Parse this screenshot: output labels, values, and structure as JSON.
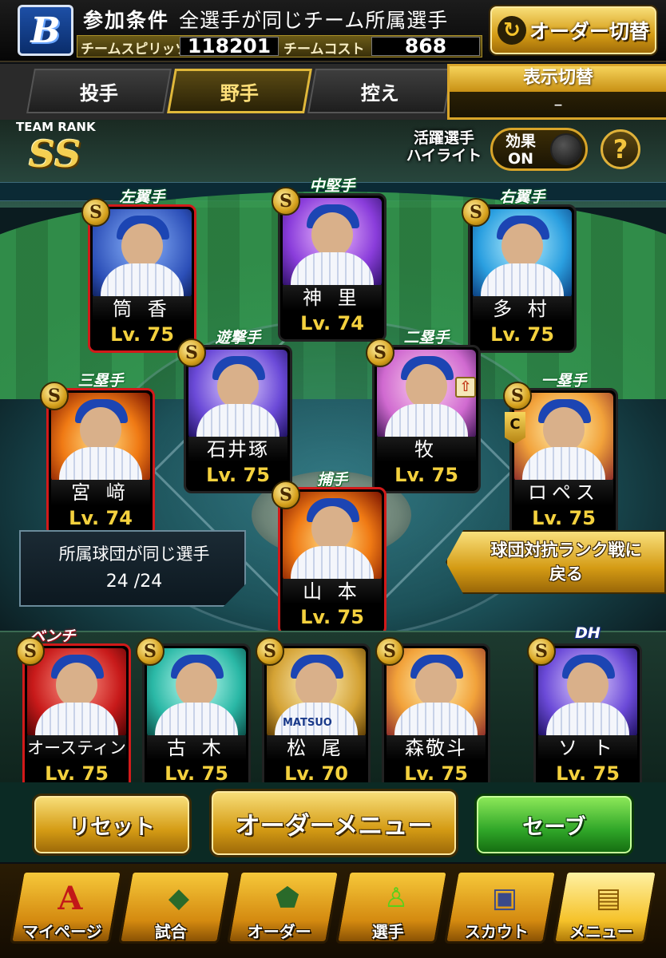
{
  "header": {
    "team_logo": "B",
    "condition_label": "参加条件",
    "condition_text": "全選手が同じチーム所属選手",
    "team_spirit_label": "チームスピリッツ",
    "team_spirit_value": "118201",
    "team_cost_label": "チームコスト",
    "team_cost_value": "868",
    "order_switch_label": "オーダー切替",
    "order_switch_icon": "cycle-arrows-icon"
  },
  "tabs": [
    {
      "label": "投手",
      "active": false
    },
    {
      "label": "野手",
      "active": true
    },
    {
      "label": "控え",
      "active": false
    }
  ],
  "display_switch": {
    "title": "表示切替",
    "value": "–"
  },
  "team_rank": {
    "label": "TEAM RANK",
    "value": "SS"
  },
  "highlight": {
    "label_line1": "活躍選手",
    "label_line2": "ハイライト",
    "effect_label": "効果",
    "effect_state": "ON",
    "help": "?"
  },
  "players": {
    "lf": {
      "position": "左翼手",
      "name": "筒 香",
      "level": "Lv. 75"
    },
    "cf": {
      "position": "中堅手",
      "name": "神 里",
      "level": "Lv. 74"
    },
    "rf": {
      "position": "右翼手",
      "name": "多 村",
      "level": "Lv. 75"
    },
    "ss": {
      "position": "遊撃手",
      "name": "石井琢",
      "level": "Lv. 75"
    },
    "2b": {
      "position": "二塁手",
      "name": "牧",
      "level": "Lv. 75"
    },
    "3b": {
      "position": "三塁手",
      "name": "宮 﨑",
      "level": "Lv. 74"
    },
    "1b": {
      "position": "一塁手",
      "name": "ロペス",
      "level": "Lv. 75"
    },
    "c": {
      "position": "捕手",
      "name": "山 本",
      "level": "Lv. 75"
    }
  },
  "same_team": {
    "label": "所属球団が同じ選手",
    "value": "24 /24"
  },
  "rank_battle": {
    "line1": "球団対抗ランク戦に",
    "line2": "戻る"
  },
  "bench": [
    {
      "position": "ベンチ",
      "name": "オースティン",
      "level": "Lv. 75"
    },
    {
      "position": "",
      "name": "古 木",
      "level": "Lv. 75"
    },
    {
      "position": "",
      "name": "松 尾",
      "level": "Lv. 70"
    },
    {
      "position": "",
      "name": "森敬斗",
      "level": "Lv. 75"
    },
    {
      "position": "DH",
      "name": "ソ ト",
      "level": "Lv. 75"
    }
  ],
  "actions": {
    "reset": "リセット",
    "order_menu": "オーダーメニュー",
    "save": "セーブ"
  },
  "nav": [
    {
      "label": "マイページ",
      "icon": "mypage-a-icon"
    },
    {
      "label": "試合",
      "icon": "stadium-icon"
    },
    {
      "label": "オーダー",
      "icon": "field-order-icon"
    },
    {
      "label": "選手",
      "icon": "player-icon"
    },
    {
      "label": "スカウト",
      "icon": "scout-card-icon"
    },
    {
      "label": "メニュー",
      "icon": "menu-character-icon"
    }
  ],
  "badge_letter": "S",
  "bench_extra": {
    "matsuo_jersey": "MATSUO",
    "lopez_badge": "C"
  },
  "colors": {
    "gold": "#f4d13e",
    "accent_gold": "#d9a52a",
    "green_button": "#2fa628",
    "red_border": "#d21a1a"
  }
}
